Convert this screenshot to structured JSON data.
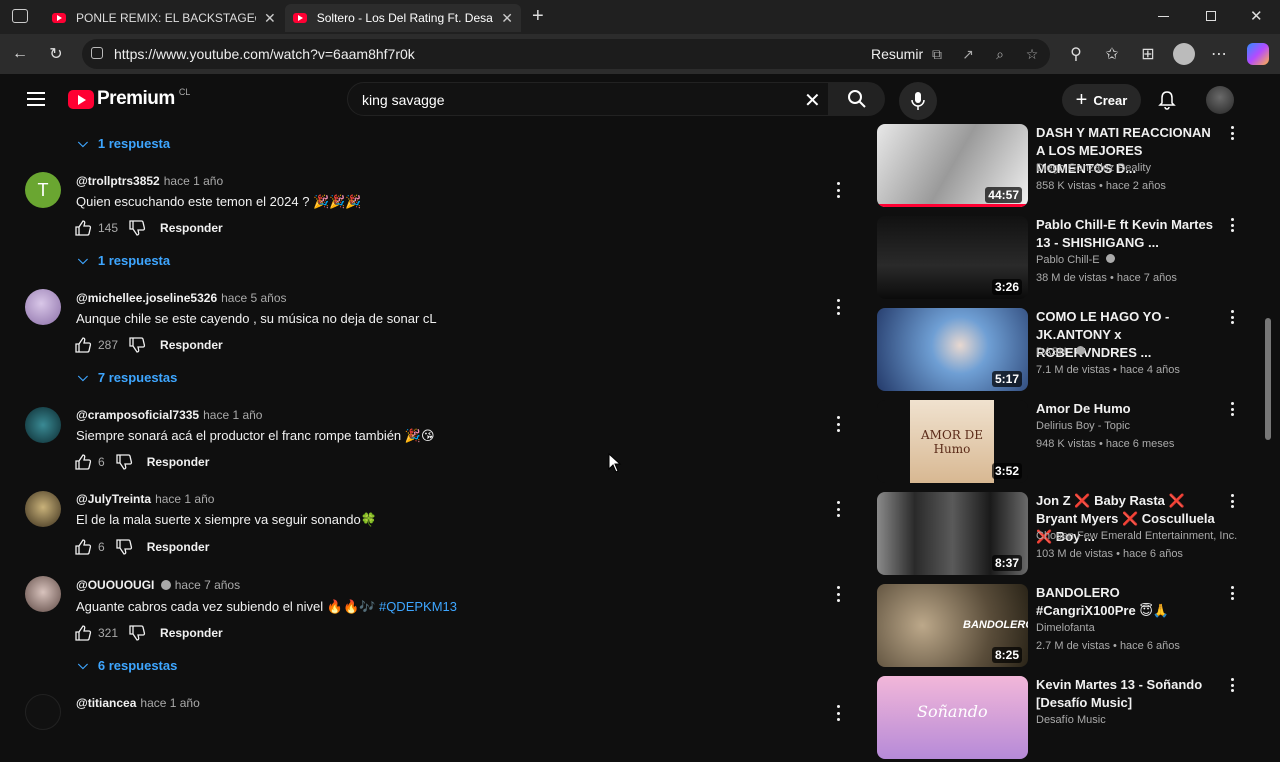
{
  "browser": {
    "tabs": [
      {
        "title": "PONLE REMIX: EL BACKSTAGE😱 |",
        "active": false
      },
      {
        "title": "Soltero - Los Del Rating Ft. Desafío",
        "active": true
      }
    ],
    "url": "https://www.youtube.com/watch?v=6aam8hf7r0k",
    "summarize_label": "Resumir"
  },
  "youtube": {
    "logo_text": "Premium",
    "region": "CL",
    "search_value": "king savagge",
    "create_label": "Crear"
  },
  "comments": [
    {
      "replies_label": "1 respuesta"
    },
    {
      "avatar_letter": "T",
      "avatar_color": "#6aa631",
      "user": "@trollptrs3852",
      "time": "hace 1 año",
      "text": "Quien escuchando este temon el 2024 ? 🎉🎉🎉",
      "likes": "145",
      "reply_label": "Responder",
      "replies_label": "1 respuesta"
    },
    {
      "avatar_color": "#a88fc4",
      "user": "@michellee.joseline5326",
      "time": "hace 5 años",
      "text": "Aunque chile se este cayendo , su música no deja de sonar cL",
      "likes": "287",
      "reply_label": "Responder",
      "replies_label": "7 respuestas"
    },
    {
      "avatar_color": "#1e4f5a",
      "user": "@cramposoficial7335",
      "time": "hace 1 año",
      "text": "Siempre sonará acá el productor el franc rompe también 🎉😘",
      "likes": "6",
      "reply_label": "Responder"
    },
    {
      "avatar_color": "#6b5a3a",
      "user": "@JulyTreinta",
      "time": "hace 1 año",
      "text": "El de la mala suerte x siempre va seguir sonando🍀",
      "likes": "6",
      "reply_label": "Responder"
    },
    {
      "avatar_color": "#8a6f6a",
      "user": "@OUOUOUGI",
      "time": "hace 7 años",
      "text": "Aguante cabros cada vez subiendo el nivel 🔥🔥🎶",
      "hashtag": "#QDEPKM13",
      "likes": "321",
      "reply_label": "Responder",
      "replies_label": "6 respuestas"
    },
    {
      "avatar_color": "#111111",
      "user": "@titiancea",
      "time": "hace 1 año"
    }
  ],
  "videos": [
    {
      "title": "DASH Y MATI REACCIONAN A LOS MEJORES MOMENTOS D...",
      "channel": "Diego González Reality",
      "meta": "858 K vistas • hace 2 años",
      "duration": "44:57",
      "thumb_color": "#cfcfcf"
    },
    {
      "title": "Pablo Chill-E ft Kevin Martes 13 - SHISHIGANG ...",
      "channel": "Pablo Chill-E",
      "meta": "38 M de vistas • hace 7 años",
      "duration": "3:26",
      "thumb_color": "#1a1a1a"
    },
    {
      "title": "COMO LE HAGO YO - JK.ANTONY x ROBERVNDRES ...",
      "channel": "DASH",
      "meta": "7.1 M de vistas • hace 4 años",
      "duration": "5:17",
      "thumb_color": "#5a8fc7"
    },
    {
      "title": "Amor De Humo",
      "channel": "Delirius Boy - Topic",
      "meta": "948 K vistas • hace 6 meses",
      "duration": "3:52",
      "thumb_color": "#e8d2b8",
      "thumb_text": "AMOR DE Humo"
    },
    {
      "title": "Jon Z ❌ Baby Rasta ❌ Bryant Myers ❌ Cosculluela ❌ Boy ...",
      "channel": "Chosen Few Emerald Entertainment, Inc.",
      "meta": "103 M de vistas • hace 6 años",
      "duration": "8:37",
      "thumb_color": "#3a3a3a"
    },
    {
      "title": "BANDOLERO #CangriX100Pre 😇🙏",
      "channel": "Dimelofanta",
      "meta": "2.7 M de vistas • hace 6 años",
      "duration": "8:25",
      "thumb_color": "#8a7a62",
      "thumb_text": "BANDOLERO"
    },
    {
      "title": "Kevin Martes 13 - Soñando [Desafío Music]",
      "channel": "Desafío Music",
      "meta": "",
      "duration": "",
      "thumb_color": "#c49ad0",
      "thumb_text": "Soñando"
    }
  ]
}
